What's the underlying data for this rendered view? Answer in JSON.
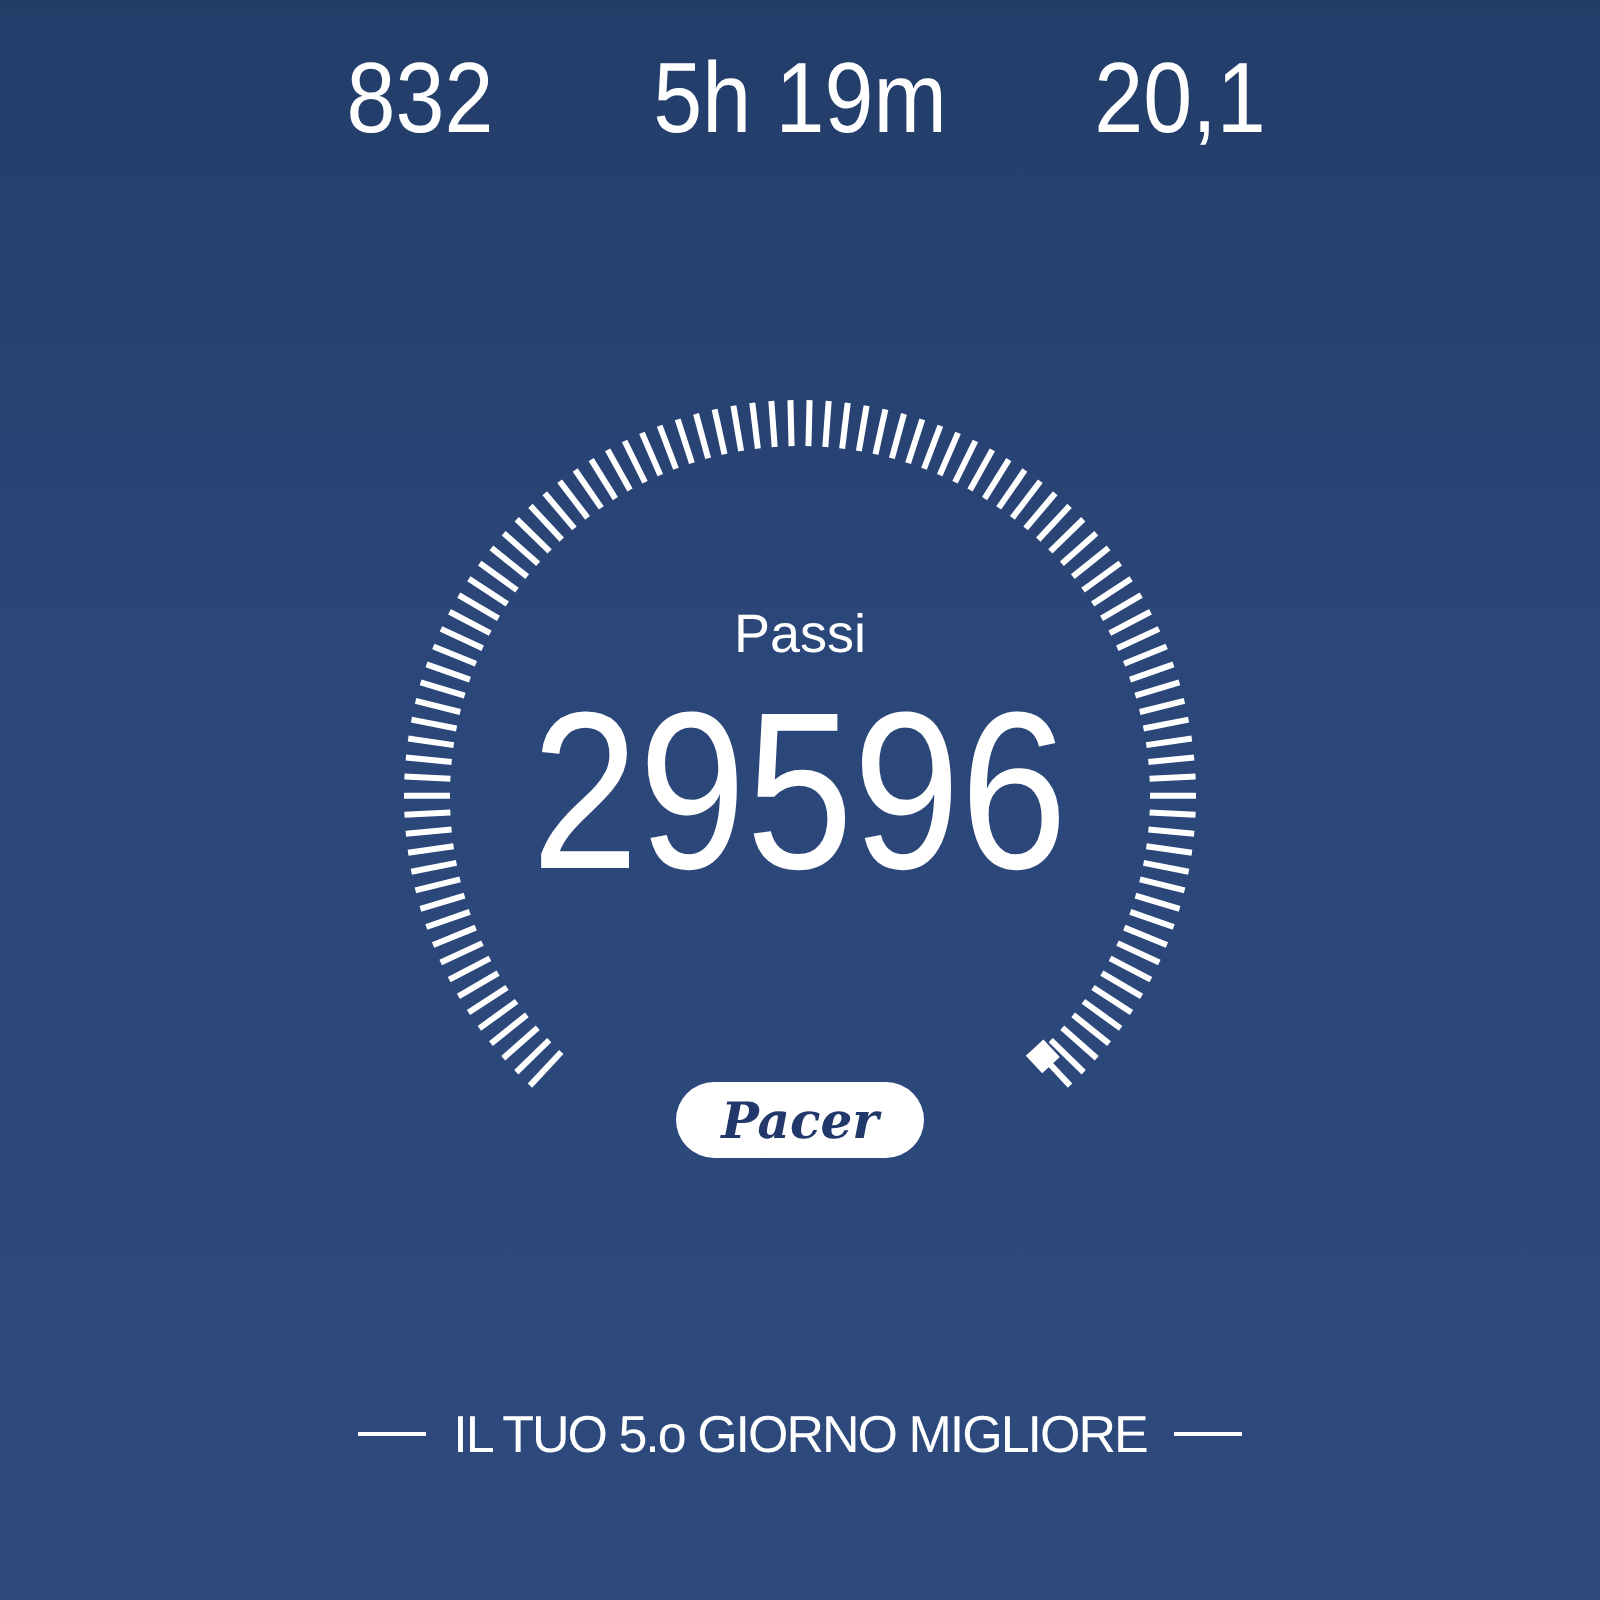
{
  "stats": [
    {
      "value": "832"
    },
    {
      "value": "5h 19m"
    },
    {
      "value": "20,1"
    }
  ],
  "gauge": {
    "label": "Passi",
    "value": "29596"
  },
  "logo": "Pacer",
  "rank_text": "IL TUO 5.o GIORNO MIGLIORE"
}
